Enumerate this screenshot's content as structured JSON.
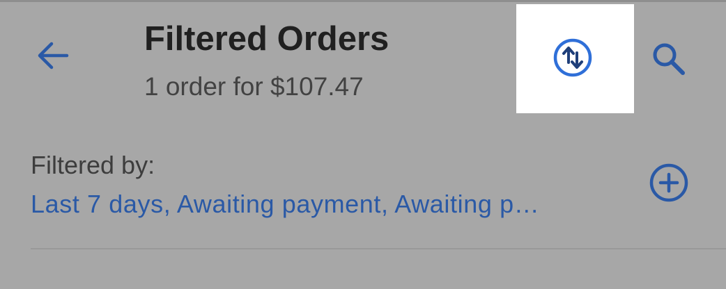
{
  "header": {
    "back_icon": "arrow-left-icon",
    "title": "Filtered Orders",
    "subtitle": "1 order for $107.47",
    "sort_icon": "sort-arrows-circle-icon",
    "search_icon": "search-icon"
  },
  "filters": {
    "label": "Filtered by:",
    "value": "Last 7 days, Awaiting payment, Awaiting p…",
    "add_icon": "plus-circle-icon"
  },
  "colors": {
    "background": "#a7a7a7",
    "accent": "#2a59a6",
    "highlight": "#ffffff",
    "sort_icon": "#2f6fd8"
  }
}
